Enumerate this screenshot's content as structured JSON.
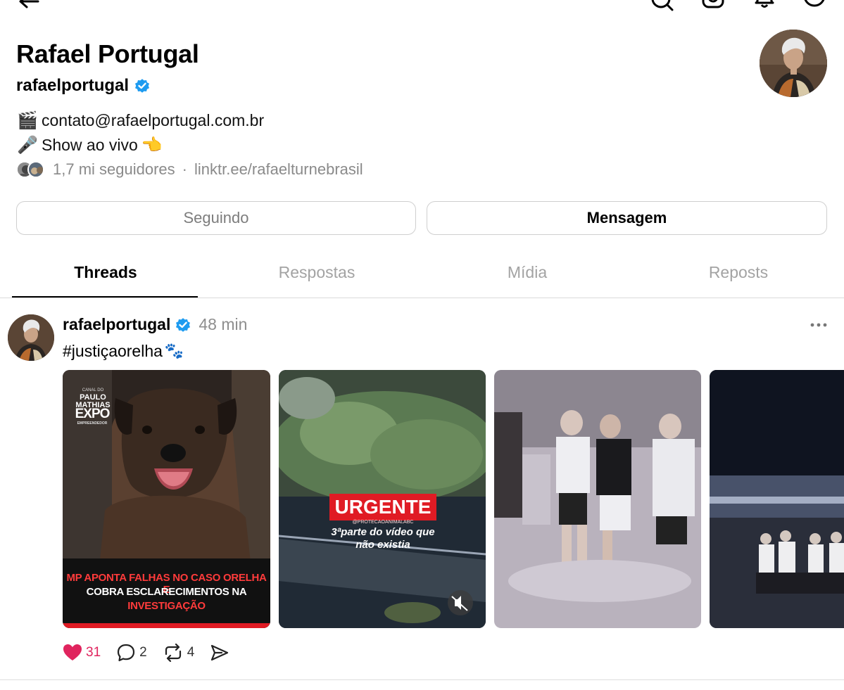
{
  "profile": {
    "name": "Rafael Portugal",
    "handle": "rafaelportugal",
    "bio_line1_emoji": "🎬",
    "bio_line1_text": "contato@rafaelportugal.com.br",
    "bio_line2_emoji": "🎤",
    "bio_line2_text": "Show ao vivo",
    "bio_line2_end_emoji": "👈",
    "followers": "1,7 mi seguidores",
    "separator": "·",
    "link": "linktr.ee/rafaelturnebrasil"
  },
  "buttons": {
    "following": "Seguindo",
    "message": "Mensagem"
  },
  "tabs": [
    {
      "label": "Threads",
      "active": true
    },
    {
      "label": "Respostas",
      "active": false
    },
    {
      "label": "Mídia",
      "active": false
    },
    {
      "label": "Reposts",
      "active": false
    }
  ],
  "post": {
    "user": "rafaelportugal",
    "time": "48 min",
    "text": "#justiçaorelha",
    "text_emoji": "🐾",
    "likes": "31",
    "replies": "2",
    "reposts": "4",
    "media": [
      {
        "channel_top": "CANAL DO",
        "channel_name_1": "PAULO",
        "channel_name_2": "MATHIAS",
        "expo": "EXPO",
        "expo_sub": "EMPREENDEDOR",
        "headline_1": "MP APONTA FALHAS NO CASO ORELHA E",
        "headline_2": "COBRA ESCLARECIMENTOS NA",
        "headline_3": "INVESTIGAÇÃO"
      },
      {
        "badge": "URGENTE",
        "source": "@PROTECAOANIMALABC",
        "caption_1": "3ªparte do vídeo que",
        "caption_2": "não existia",
        "mute_icon": "muted-speaker-icon"
      },
      {},
      {}
    ]
  },
  "colors": {
    "verified": "#1d9bf0",
    "like": "#e0245e",
    "urgent_red": "#e01b24",
    "headline_red": "#ff3b3b"
  }
}
